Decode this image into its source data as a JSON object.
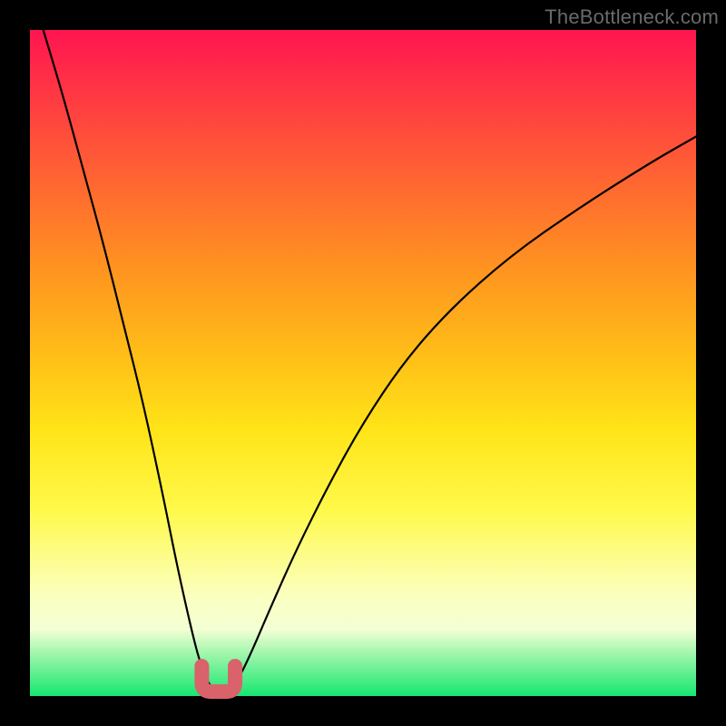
{
  "watermark": "TheBottleneck.com",
  "colors": {
    "background": "#000000",
    "curve": "#000000",
    "highlight": "#d9626b"
  },
  "chart_data": {
    "type": "line",
    "title": "",
    "xlabel": "",
    "ylabel": "",
    "xlim": [
      0,
      100
    ],
    "ylim": [
      0,
      100
    ],
    "grid": false,
    "legend": false,
    "series": [
      {
        "name": "bottleneck-curve",
        "x": [
          2,
          5,
          8,
          11,
          14,
          17,
          20,
          22,
          24,
          25.5,
          27,
          28,
          29,
          30,
          31,
          33,
          36,
          40,
          45,
          50,
          56,
          63,
          72,
          82,
          93,
          100
        ],
        "y": [
          100,
          90,
          79,
          68,
          56,
          44,
          30,
          20,
          11,
          5,
          1.5,
          0.6,
          0.4,
          0.8,
          2,
          6,
          13,
          22,
          32,
          41,
          50,
          58,
          66,
          73,
          80,
          84
        ]
      }
    ],
    "annotations": [
      {
        "name": "optimal-region",
        "type": "u-highlight",
        "x_range": [
          25.8,
          30.8
        ],
        "y_min": 0.4
      }
    ]
  }
}
